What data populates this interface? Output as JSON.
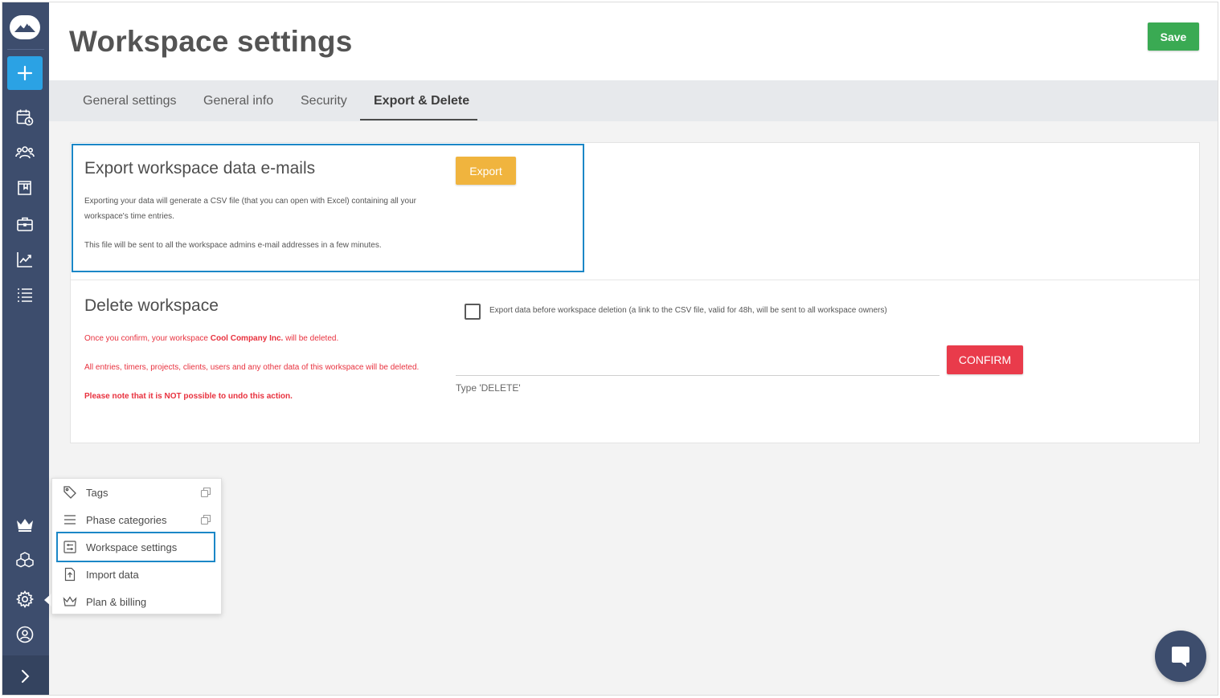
{
  "header": {
    "title": "Workspace settings",
    "save_label": "Save"
  },
  "tabs": [
    {
      "label": "General settings"
    },
    {
      "label": "General info"
    },
    {
      "label": "Security"
    },
    {
      "label": "Export & Delete",
      "active": true
    }
  ],
  "export_section": {
    "title": "Export workspace data e-mails",
    "button": "Export",
    "desc_line1": "Exporting your data will generate a CSV file (that you can open with Excel) containing all your",
    "desc_line2": "workspace's time entries.",
    "desc_line3": "This file will be sent to all the workspace admins e-mail addresses in a few minutes."
  },
  "delete_section": {
    "title": "Delete workspace",
    "line1_prefix": "Once you confirm, your workspace ",
    "workspace_name": "Cool Company Inc.",
    "line1_suffix": " will be deleted.",
    "line2": "All entries, timers, projects, clients, users and any other data of this workspace will be deleted.",
    "line3": "Please note that it is NOT possible to undo this action.",
    "checkbox_label": "Export data before workspace deletion (a link to the CSV file, valid for 48h, will be sent to all workspace owners)",
    "input_value": "",
    "input_hint": "Type 'DELETE'",
    "confirm_label": "CONFIRM"
  },
  "settings_menu": {
    "items": [
      {
        "label": "Tags",
        "icon": "tag-icon"
      },
      {
        "label": "Phase categories",
        "icon": "list-icon"
      },
      {
        "label": "Workspace settings",
        "icon": "settings-sliders-icon",
        "highlighted": true
      },
      {
        "label": "Import data",
        "icon": "file-upload-icon"
      },
      {
        "label": "Plan & billing",
        "icon": "crown-icon"
      }
    ]
  },
  "colors": {
    "sidebar": "#3d4d6d",
    "accent_blue": "#2ba2e4",
    "save_green": "#3aaa53",
    "export_orange": "#f0b43e",
    "danger_red": "#e93b4b",
    "highlight_outline": "#1b87c7"
  }
}
